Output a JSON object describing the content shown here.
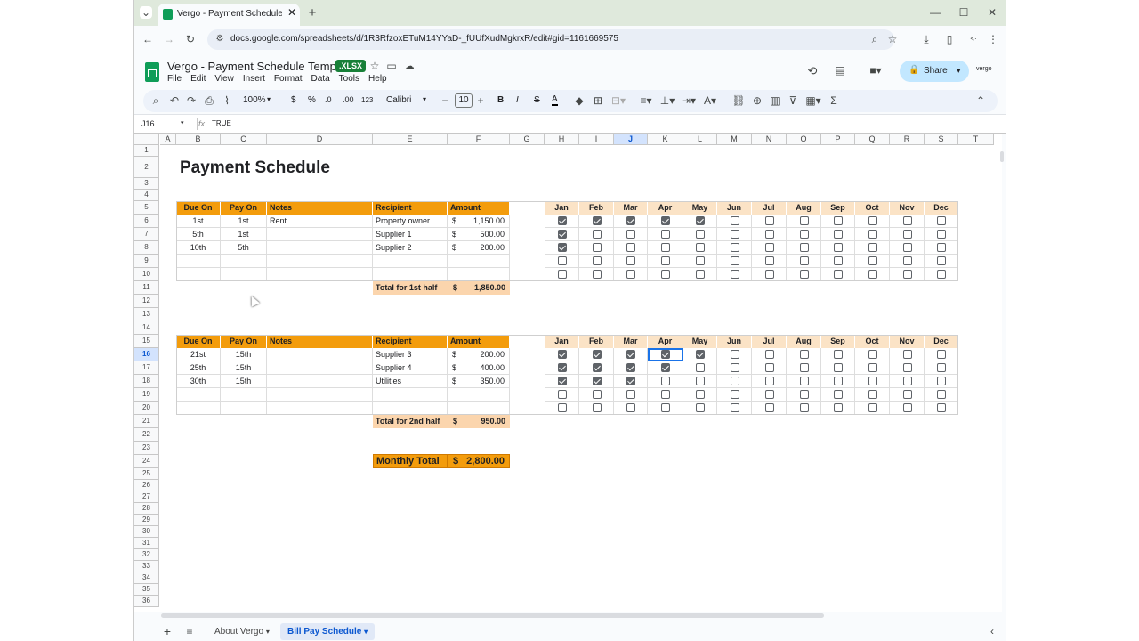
{
  "browser": {
    "tab_title": "Vergo - Payment Schedule Tem",
    "url": "docs.google.com/spreadsheets/d/1R3RfzoxETuM14YYaD-_fUUfXudMgkrxR/edit#gid=1161669575"
  },
  "doc": {
    "title": "Vergo - Payment Schedule Template",
    "badge": ".XLSX",
    "menus": [
      "File",
      "Edit",
      "View",
      "Insert",
      "Format",
      "Data",
      "Tools",
      "Help"
    ],
    "share_label": "Share",
    "brand": "vergo"
  },
  "toolbar": {
    "zoom": "100%",
    "currency": "$",
    "percent": "%",
    "dec_less": ".0",
    "dec_more": ".00",
    "format_num": "123",
    "font": "Calibri",
    "font_size": "10",
    "bold": "B",
    "italic": "I",
    "strike": "S",
    "text_color": "A"
  },
  "formula": {
    "cell_ref": "J16",
    "fx": "fx",
    "content": "TRUE"
  },
  "columns": [
    "A",
    "B",
    "C",
    "D",
    "E",
    "F",
    "G",
    "H",
    "I",
    "J",
    "K",
    "L",
    "M",
    "N",
    "O",
    "P",
    "Q",
    "R",
    "S",
    "T"
  ],
  "rows": [
    "1",
    "2",
    "3",
    "4",
    "5",
    "6",
    "7",
    "8",
    "9",
    "10",
    "11",
    "12",
    "13",
    "14",
    "15",
    "16",
    "17",
    "18",
    "19",
    "20",
    "21",
    "22",
    "23",
    "24",
    "25",
    "26",
    "27",
    "28",
    "29",
    "30",
    "31",
    "32",
    "33",
    "34",
    "35",
    "36"
  ],
  "sheet": {
    "title": "Payment Schedule",
    "headers": {
      "due": "Due On",
      "pay": "Pay On",
      "notes": "Notes",
      "recipient": "Recipient",
      "amount": "Amount"
    },
    "months": [
      "Jan",
      "Feb",
      "Mar",
      "Apr",
      "May",
      "Jun",
      "Jul",
      "Aug",
      "Sep",
      "Oct",
      "Nov",
      "Dec"
    ],
    "t1": [
      {
        "due": "1st",
        "pay": "1st",
        "notes": "Rent",
        "recipient": "Property owner",
        "cur": "$",
        "amount": "1,150.00",
        "checks": [
          1,
          1,
          1,
          1,
          1,
          0,
          0,
          0,
          0,
          0,
          0,
          0
        ]
      },
      {
        "due": "5th",
        "pay": "1st",
        "notes": "",
        "recipient": "Supplier 1",
        "cur": "$",
        "amount": "500.00",
        "checks": [
          1,
          0,
          0,
          0,
          0,
          0,
          0,
          0,
          0,
          0,
          0,
          0
        ]
      },
      {
        "due": "10th",
        "pay": "5th",
        "notes": "",
        "recipient": "Supplier 2",
        "cur": "$",
        "amount": "200.00",
        "checks": [
          1,
          0,
          0,
          0,
          0,
          0,
          0,
          0,
          0,
          0,
          0,
          0
        ]
      },
      {
        "due": "",
        "pay": "",
        "notes": "",
        "recipient": "",
        "cur": "",
        "amount": "",
        "checks": [
          0,
          0,
          0,
          0,
          0,
          0,
          0,
          0,
          0,
          0,
          0,
          0
        ]
      },
      {
        "due": "",
        "pay": "",
        "notes": "",
        "recipient": "",
        "cur": "",
        "amount": "",
        "checks": [
          0,
          0,
          0,
          0,
          0,
          0,
          0,
          0,
          0,
          0,
          0,
          0
        ]
      }
    ],
    "t1_total": {
      "label": "Total for 1st half",
      "cur": "$",
      "value": "1,850.00"
    },
    "t2": [
      {
        "due": "21st",
        "pay": "15th",
        "notes": "",
        "recipient": "Supplier 3",
        "cur": "$",
        "amount": "200.00",
        "checks": [
          1,
          1,
          1,
          1,
          1,
          0,
          0,
          0,
          0,
          0,
          0,
          0
        ]
      },
      {
        "due": "25th",
        "pay": "15th",
        "notes": "",
        "recipient": "Supplier 4",
        "cur": "$",
        "amount": "400.00",
        "checks": [
          1,
          1,
          1,
          1,
          0,
          0,
          0,
          0,
          0,
          0,
          0,
          0
        ]
      },
      {
        "due": "30th",
        "pay": "15th",
        "notes": "",
        "recipient": "Utilities",
        "cur": "$",
        "amount": "350.00",
        "checks": [
          1,
          1,
          1,
          0,
          0,
          0,
          0,
          0,
          0,
          0,
          0,
          0
        ]
      },
      {
        "due": "",
        "pay": "",
        "notes": "",
        "recipient": "",
        "cur": "",
        "amount": "",
        "checks": [
          0,
          0,
          0,
          0,
          0,
          0,
          0,
          0,
          0,
          0,
          0,
          0
        ]
      },
      {
        "due": "",
        "pay": "",
        "notes": "",
        "recipient": "",
        "cur": "",
        "amount": "",
        "checks": [
          0,
          0,
          0,
          0,
          0,
          0,
          0,
          0,
          0,
          0,
          0,
          0
        ]
      }
    ],
    "t2_total": {
      "label": "Total for 2nd half",
      "cur": "$",
      "value": "950.00"
    },
    "monthly": {
      "label": "Monthly Total",
      "cur": "$",
      "value": "2,800.00"
    }
  },
  "sheets": [
    {
      "label": "About Vergo",
      "active": false
    },
    {
      "label": "Bill Pay Schedule",
      "active": true
    }
  ],
  "colors": {
    "header_orange": "#f39c0c",
    "month_header": "#fbe3c6",
    "total_bg": "#fbd5ad",
    "sheets_green": "#0f9d58",
    "active_tab": "#e1e9f7"
  }
}
